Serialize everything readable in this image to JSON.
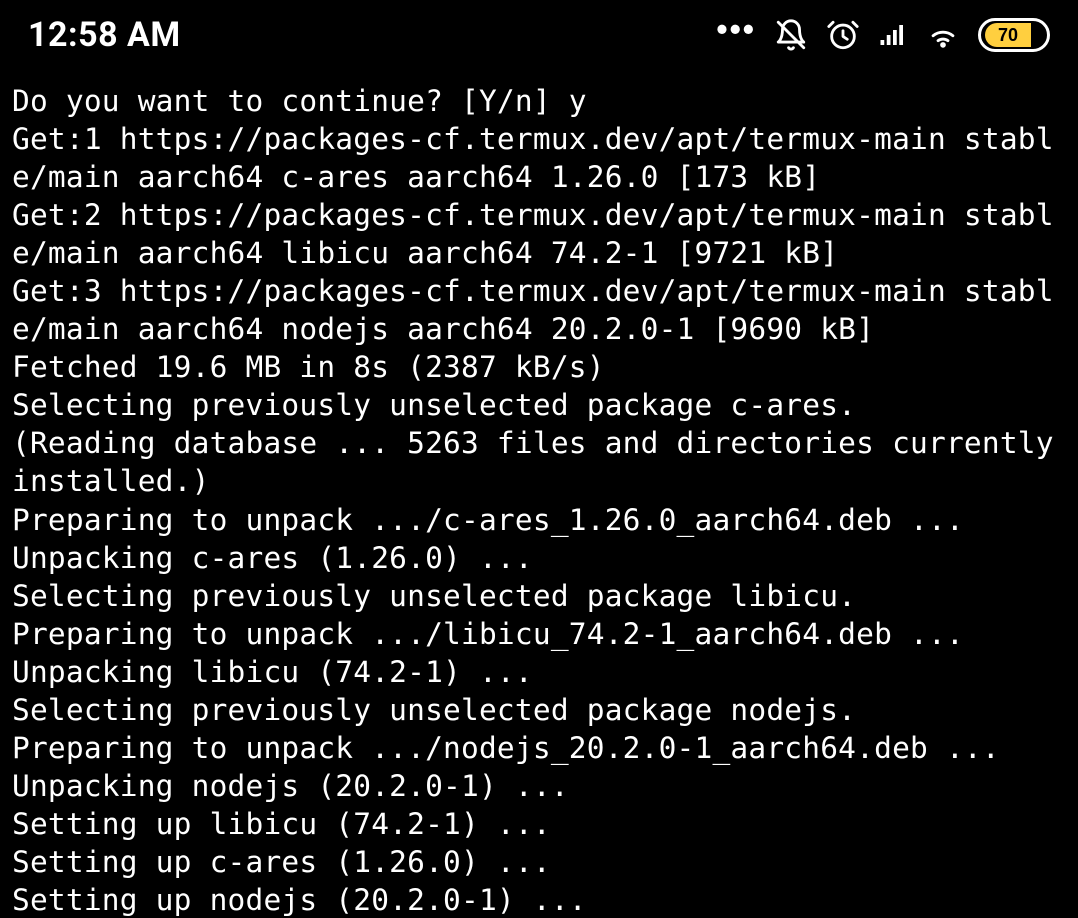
{
  "status": {
    "time": "12:58 AM",
    "battery": "70"
  },
  "terminal": {
    "lines": [
      "Do you want to continue? [Y/n] y",
      "Get:1 https://packages-cf.termux.dev/apt/termux-main stable/main aarch64 c-ares aarch64 1.26.0 [173 kB]",
      "Get:2 https://packages-cf.termux.dev/apt/termux-main stable/main aarch64 libicu aarch64 74.2-1 [9721 kB]",
      "Get:3 https://packages-cf.termux.dev/apt/termux-main stable/main aarch64 nodejs aarch64 20.2.0-1 [9690 kB]",
      "Fetched 19.6 MB in 8s (2387 kB/s)",
      "Selecting previously unselected package c-ares.",
      "(Reading database ... 5263 files and directories currently installed.)",
      "Preparing to unpack .../c-ares_1.26.0_aarch64.deb ...",
      "Unpacking c-ares (1.26.0) ...",
      "Selecting previously unselected package libicu.",
      "Preparing to unpack .../libicu_74.2-1_aarch64.deb ...",
      "Unpacking libicu (74.2-1) ...",
      "Selecting previously unselected package nodejs.",
      "Preparing to unpack .../nodejs_20.2.0-1_aarch64.deb ...",
      "Unpacking nodejs (20.2.0-1) ...",
      "Setting up libicu (74.2-1) ...",
      "Setting up c-ares (1.26.0) ...",
      "Setting up nodejs (20.2.0-1) ..."
    ]
  }
}
